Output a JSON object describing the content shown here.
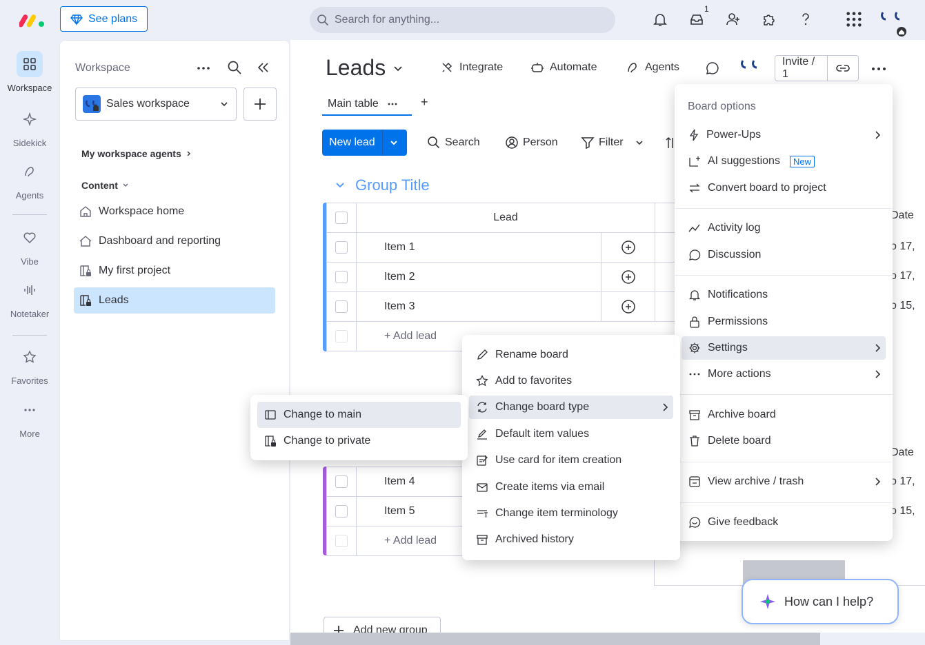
{
  "topbar": {
    "see_plans": "See plans",
    "search_placeholder": "Search for anything...",
    "inbox_badge": "1",
    "avatar_text": "'R F"
  },
  "rail": {
    "items": [
      {
        "label": "Workspace",
        "icon": "workspace-icon"
      },
      {
        "label": "Sidekick",
        "icon": "sparkle-icon"
      },
      {
        "label": "Agents",
        "icon": "agents-icon"
      },
      {
        "label": "Vibe",
        "icon": "heart-icon"
      },
      {
        "label": "Notetaker",
        "icon": "waveform-icon"
      },
      {
        "label": "Favorites",
        "icon": "star-icon"
      },
      {
        "label": "More",
        "icon": "more-icon"
      }
    ]
  },
  "sidebar": {
    "title": "Workspace",
    "workspace_name": "Sales workspace",
    "agents_heading": "My workspace agents",
    "content_heading": "Content",
    "links": [
      {
        "label": "Workspace home",
        "icon": "home-icon"
      },
      {
        "label": "Dashboard and reporting",
        "icon": "dashboard-icon"
      },
      {
        "label": "My first project",
        "icon": "private-board-icon"
      },
      {
        "label": "Leads",
        "icon": "private-board-icon"
      }
    ]
  },
  "board": {
    "title": "Leads",
    "integrate": "Integrate",
    "automate": "Automate",
    "agents": "Agents",
    "invite": "Invite / 1",
    "tab": "Main table",
    "tab_add": "+",
    "new_lead": "New lead",
    "tools": [
      "Search",
      "Person",
      "Filter"
    ],
    "group_title": "Group Title",
    "lead_header": "Lead",
    "date_header": "Date",
    "group1_items": [
      "Item 1",
      "Item 2",
      "Item 3"
    ],
    "group1_dates": [
      "o 17,",
      "o 17,",
      "o 15,"
    ],
    "group2_items": [
      "Item 4",
      "Item 5"
    ],
    "group2_dates": [
      "o 17,",
      "o 15,"
    ],
    "add_lead": "+ Add lead",
    "add_group": "Add new group"
  },
  "board_options": {
    "title": "Board options",
    "items": [
      {
        "label": "Power-Ups",
        "icon": "bolt-icon",
        "submenu": true
      },
      {
        "label": "AI suggestions",
        "icon": "ai-icon",
        "tag": "New"
      },
      {
        "label": "Convert board to project",
        "icon": "convert-icon"
      },
      {
        "label": "Activity log",
        "icon": "activity-icon"
      },
      {
        "label": "Discussion",
        "icon": "chat-icon"
      },
      {
        "label": "Notifications",
        "icon": "bell-icon"
      },
      {
        "label": "Permissions",
        "icon": "lock-icon"
      },
      {
        "label": "Settings",
        "icon": "gear-icon",
        "submenu": true
      },
      {
        "label": "More actions",
        "icon": "more-icon",
        "submenu": true
      },
      {
        "label": "Archive board",
        "icon": "archive-icon"
      },
      {
        "label": "Delete board",
        "icon": "trash-icon"
      },
      {
        "label": "View archive / trash",
        "icon": "archive-view-icon",
        "submenu": true
      },
      {
        "label": "Give feedback",
        "icon": "feedback-icon"
      }
    ]
  },
  "settings_menu": {
    "items": [
      {
        "label": "Rename board",
        "icon": "pencil-icon"
      },
      {
        "label": "Add to favorites",
        "icon": "star-icon"
      },
      {
        "label": "Change board type",
        "icon": "swap-icon",
        "submenu": true
      },
      {
        "label": "Default item values",
        "icon": "edit-icon"
      },
      {
        "label": "Use card for item creation",
        "icon": "card-icon"
      },
      {
        "label": "Create items via email",
        "icon": "mail-icon"
      },
      {
        "label": "Change item terminology",
        "icon": "terminology-icon"
      },
      {
        "label": "Archived history",
        "icon": "archive-icon"
      }
    ]
  },
  "board_type_menu": {
    "items": [
      {
        "label": "Change to main",
        "icon": "main-board-icon"
      },
      {
        "label": "Change to private",
        "icon": "private-board-icon"
      }
    ]
  },
  "help": {
    "label": "How can I help?"
  }
}
